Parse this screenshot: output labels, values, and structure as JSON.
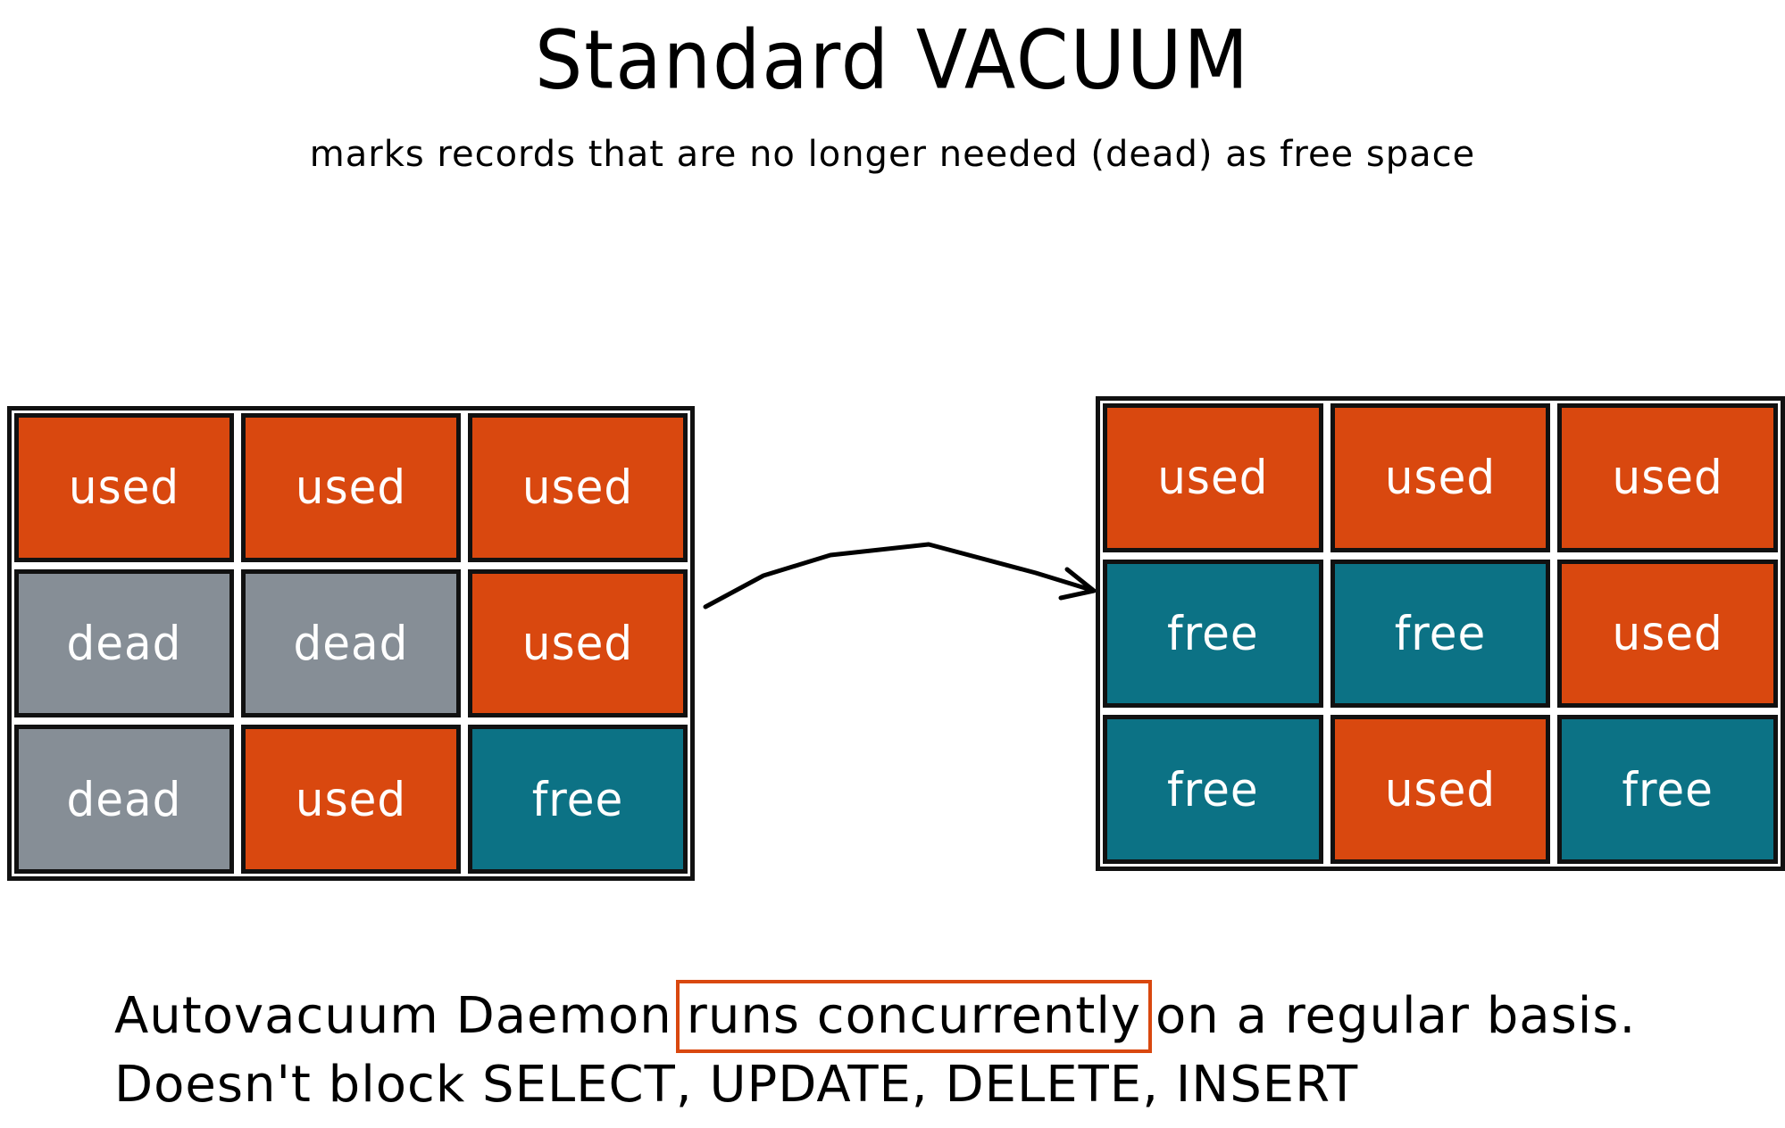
{
  "title": "Standard VACUUM",
  "subtitle": "marks records that are no longer needed (dead) as free space",
  "colors": {
    "used": "#D9480F",
    "dead": "#868E96",
    "free": "#0C7285",
    "highlight_border": "#D9480F",
    "text_on_cells": "#FFFFFF"
  },
  "before_grid": {
    "rows": [
      [
        {
          "state": "used",
          "label": "used"
        },
        {
          "state": "used",
          "label": "used"
        },
        {
          "state": "used",
          "label": "used"
        }
      ],
      [
        {
          "state": "dead",
          "label": "dead"
        },
        {
          "state": "dead",
          "label": "dead"
        },
        {
          "state": "used",
          "label": "used"
        }
      ],
      [
        {
          "state": "dead",
          "label": "dead"
        },
        {
          "state": "used",
          "label": "used"
        },
        {
          "state": "free",
          "label": "free"
        }
      ]
    ]
  },
  "after_grid": {
    "rows": [
      [
        {
          "state": "used",
          "label": "used"
        },
        {
          "state": "used",
          "label": "used"
        },
        {
          "state": "used",
          "label": "used"
        }
      ],
      [
        {
          "state": "free",
          "label": "free"
        },
        {
          "state": "free",
          "label": "free"
        },
        {
          "state": "used",
          "label": "used"
        }
      ],
      [
        {
          "state": "free",
          "label": "free"
        },
        {
          "state": "used",
          "label": "used"
        },
        {
          "state": "free",
          "label": "free"
        }
      ]
    ]
  },
  "arrow": {
    "icon": "arrow-right-icon",
    "from": "before_grid",
    "to": "after_grid"
  },
  "footer": {
    "line1_prefix": "Autovacuum Daemon",
    "line1_highlight": "runs concurrently",
    "line1_suffix": "on a regular basis.",
    "line2": "Doesn't block SELECT, UPDATE, DELETE, INSERT"
  }
}
